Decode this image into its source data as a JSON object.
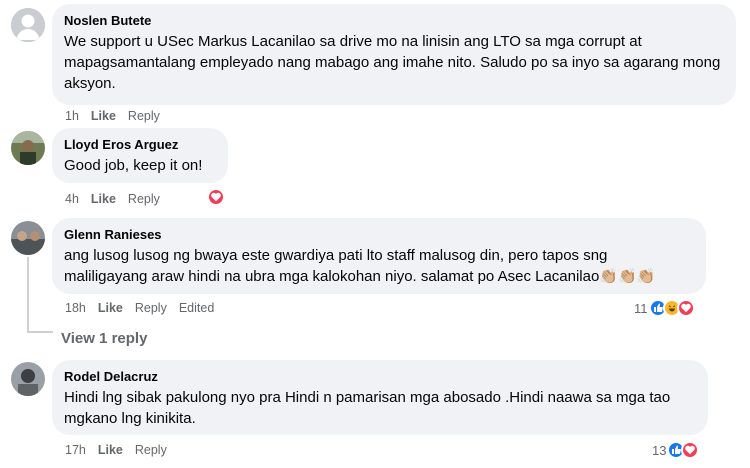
{
  "comments": [
    {
      "author": "Noslen Butete",
      "text": "We support u USec Markus Lacanilao sa drive mo na linisin ang LTO sa mga corrupt at mapagsamantalang empleyado nang mabago ang imahe nito. Saludo po sa inyo sa agarang mong aksyon.",
      "time": "1h",
      "like": "Like",
      "reply": "Reply"
    },
    {
      "author": "Lloyd Eros Arguez",
      "text": "Good job, keep it on!",
      "time": "4h",
      "like": "Like",
      "reply": "Reply",
      "reactions": [
        "heart"
      ]
    },
    {
      "author": "Glenn Ranieses",
      "text": "ang lusog lusog ng bwaya este gwardiya pati lto staff malusog din, pero tapos sng maliligayang araw hindi na ubra mga kalokohan niyo. salamat po Asec Lacanilao👏🏼👏🏼👏🏼",
      "time": "18h",
      "like": "Like",
      "reply": "Reply",
      "edited": "Edited",
      "reaction_count": "11",
      "reactions": [
        "like",
        "haha",
        "heart"
      ]
    },
    {
      "author": "Rodel Delacruz",
      "text": "Hindi lng sibak pakulong nyo pra Hindi n pamarisan mga abosado .Hindi naawa sa mga tao mgkano lng kinikita.",
      "time": "17h",
      "like": "Like",
      "reply": "Reply",
      "reaction_count": "13",
      "reactions": [
        "like",
        "heart"
      ]
    }
  ],
  "view_replies": "View 1 reply",
  "colors": {
    "bubble": "#f0f2f5",
    "meta": "#65676b",
    "like": "#1877f2",
    "heart": "#f33e58",
    "haha": "#f7b928"
  }
}
